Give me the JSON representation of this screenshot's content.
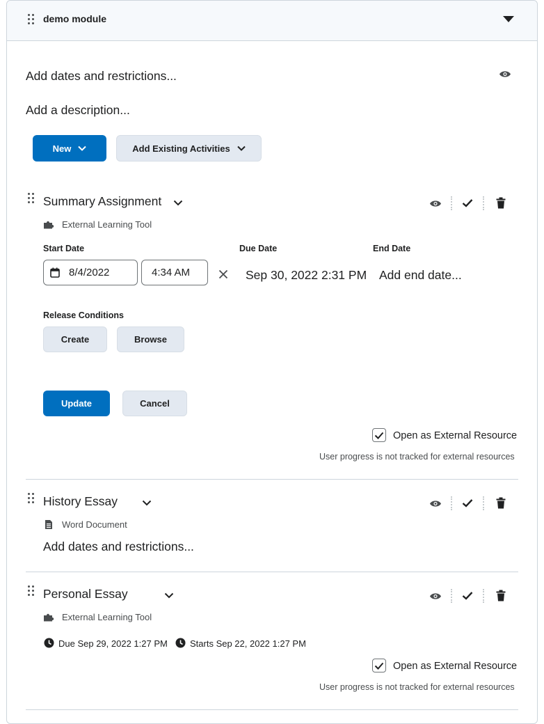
{
  "module": {
    "title": "demo module",
    "add_dates": "Add dates and restrictions...",
    "add_description": "Add a description...",
    "new_button": "New",
    "add_existing_button": "Add Existing Activities"
  },
  "items": [
    {
      "title": "Summary Assignment",
      "type": "External Learning Tool",
      "type_icon": "puzzle-icon",
      "start_date_label": "Start Date",
      "start_date_value": "8/4/2022",
      "start_time_value": "4:34 AM",
      "due_date_label": "Due Date",
      "due_date_value": "Sep 30, 2022 2:31 PM",
      "end_date_label": "End Date",
      "end_date_placeholder": "Add end date...",
      "release_conditions_label": "Release Conditions",
      "create_button": "Create",
      "browse_button": "Browse",
      "update_button": "Update",
      "cancel_button": "Cancel",
      "external_checkbox_label": "Open as External Resource",
      "external_checked": true,
      "external_note": "User progress is not tracked for external resources"
    },
    {
      "title": "History Essay",
      "type": "Word Document",
      "type_icon": "document-icon",
      "add_dates": "Add dates and restrictions..."
    },
    {
      "title": "Personal Essay",
      "type": "External Learning Tool",
      "type_icon": "puzzle-icon",
      "due": "Due Sep 29, 2022 1:27 PM",
      "starts": "Starts Sep 22, 2022 1:27 PM",
      "external_checkbox_label": "Open as External Resource",
      "external_checked": true,
      "external_note": "User progress is not tracked for external resources"
    }
  ],
  "colors": {
    "primary": "#006fbf",
    "secondary_button": "#e3e9f1",
    "header_bg": "#f6f9fc",
    "border": "#cdd5dc",
    "text": "#202122"
  }
}
